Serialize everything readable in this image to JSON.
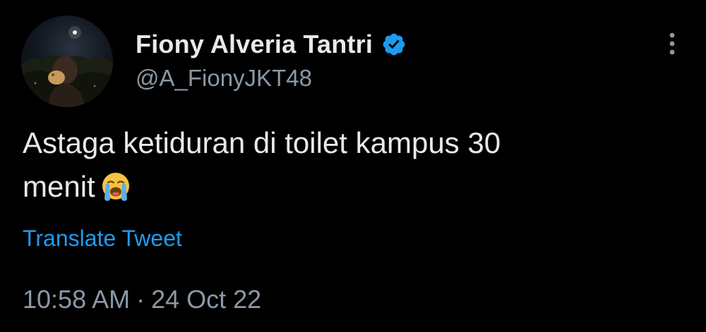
{
  "author": {
    "display_name": "Fiony Alveria Tantri",
    "handle": "@A_FionyJKT48",
    "verified_icon": "verified-badge-icon",
    "avatar_icon": "profile-photo"
  },
  "tweet": {
    "text_line1": "Astaga ketiduran di toilet kampus 30",
    "text_line2": "menit",
    "emoji": "loudly-crying-face-icon",
    "translate_label": "Translate Tweet"
  },
  "meta": {
    "time": "10:58 AM",
    "separator": "·",
    "date": "24 Oct 22"
  },
  "menu": {
    "more_icon": "more-vertical-icon"
  },
  "colors": {
    "background": "#000000",
    "primary_text": "#e7e9ea",
    "secondary_text": "#8b98a5",
    "link": "#1d9bf0",
    "verified": "#1d9bf0"
  }
}
